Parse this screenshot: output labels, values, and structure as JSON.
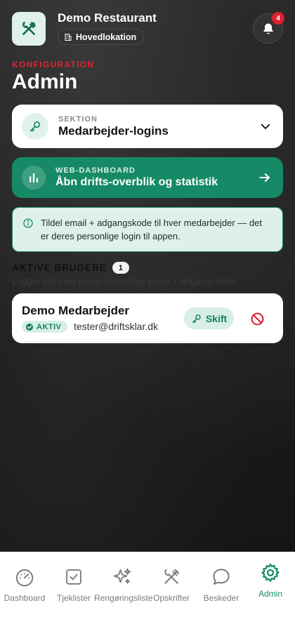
{
  "header": {
    "app_title": "Demo Restaurant",
    "location": "Hovedlokation",
    "notification_count": "4"
  },
  "page": {
    "kicker": "KONFIGURATION",
    "title": "Admin"
  },
  "section_selector": {
    "caption": "SEKTION",
    "value": "Medarbejder-logins"
  },
  "dashboard_link": {
    "caption": "WEB-DASHBOARD",
    "label": "Åbn drifts-overblik og statistik"
  },
  "info": {
    "text": "Tildel email + adgangskode til hver medarbejder — det er deres personlige login til appen."
  },
  "active_users": {
    "heading": "AKTIVE BRUGERE",
    "count": "1",
    "subtitle": "Logger ind med deres personlige email + adgangskode.",
    "users": [
      {
        "name": "Demo Medarbejder",
        "status": "AKTIV",
        "email": "tester@driftsklar.dk",
        "switch_label": "Skift"
      }
    ]
  },
  "bottom_nav": {
    "items": [
      {
        "label": "Dashboard",
        "icon": "gauge-icon"
      },
      {
        "label": "Tjeklister",
        "icon": "checkbox-icon"
      },
      {
        "label": "Rengøringsliste",
        "icon": "sparkles-icon"
      },
      {
        "label": "Opskrifter",
        "icon": "utensils-icon"
      },
      {
        "label": "Beskeder",
        "icon": "chat-icon"
      },
      {
        "label": "Admin",
        "icon": "gear-icon"
      }
    ],
    "active": "Admin"
  },
  "colors": {
    "accent": "#168a66",
    "kicker": "#e0242f",
    "badge": "#e0202e"
  }
}
